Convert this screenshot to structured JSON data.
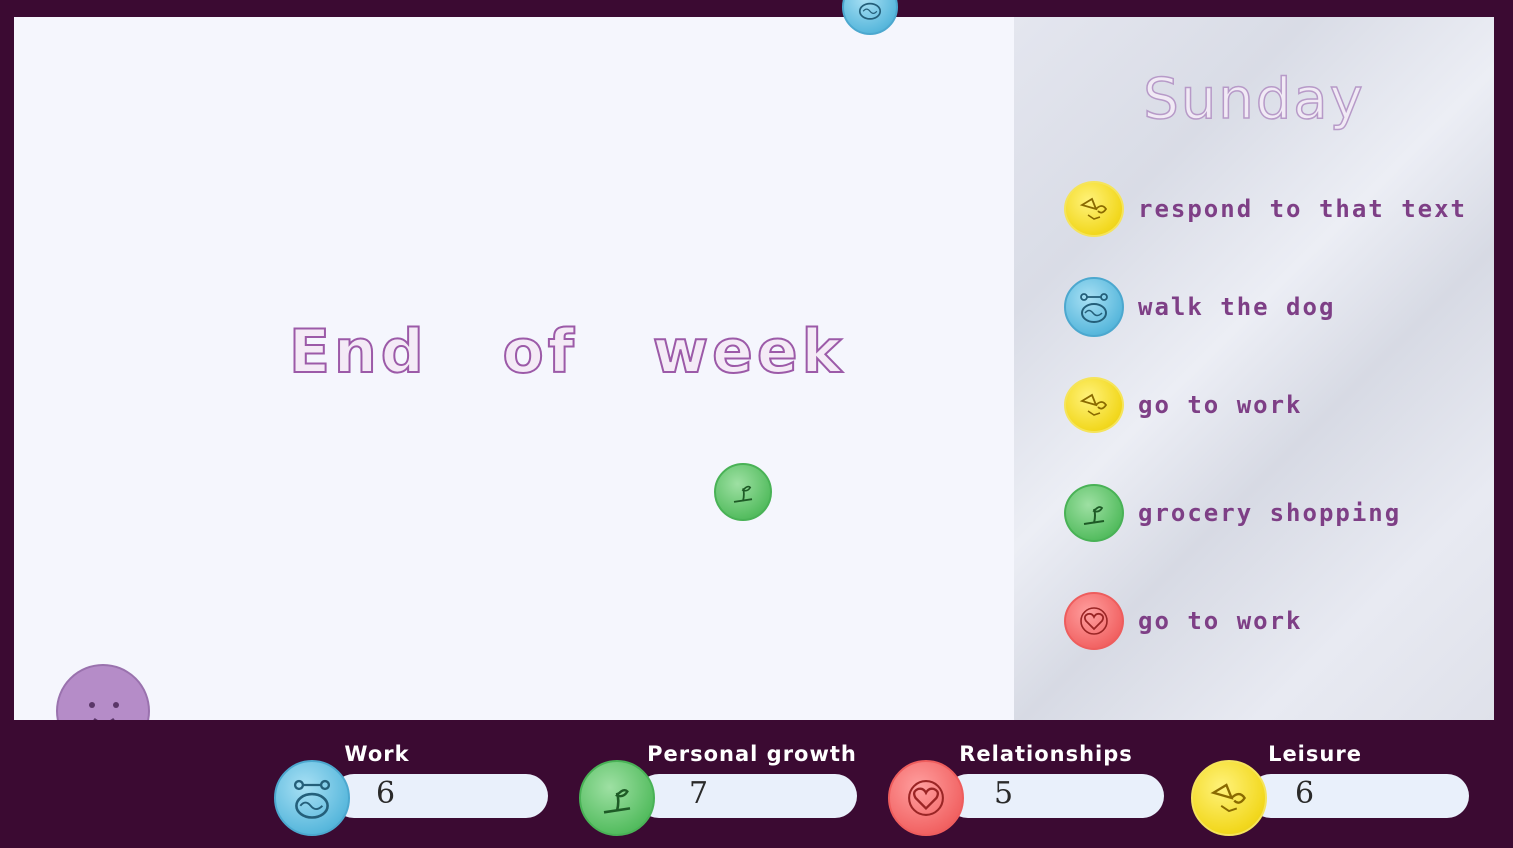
{
  "main": {
    "headline": "End of week"
  },
  "schedule": {
    "day": "Sunday",
    "tasks": [
      {
        "label": "respond to that text",
        "category": "leisure",
        "icon": "kite-icon",
        "color": "#f2d81e"
      },
      {
        "label": "walk the dog",
        "category": "work",
        "icon": "brain-dumbbell-icon",
        "color": "#5bb9dd"
      },
      {
        "label": "go to work",
        "category": "leisure",
        "icon": "kite-icon",
        "color": "#f2d81e"
      },
      {
        "label": "grocery shopping",
        "category": "personal-growth",
        "icon": "sprout-icon",
        "color": "#57be62"
      },
      {
        "label": "go to work",
        "category": "relationships",
        "icon": "heart-icon",
        "color": "#f26565"
      }
    ]
  },
  "stats": [
    {
      "label": "Work",
      "value": "6",
      "icon": "brain-dumbbell-icon",
      "color": "#5bb9dd"
    },
    {
      "label": "Personal growth",
      "value": "7",
      "icon": "sprout-icon",
      "color": "#57be62"
    },
    {
      "label": "Relationships",
      "value": "5",
      "icon": "heart-icon",
      "color": "#f26565"
    },
    {
      "label": "Leisure",
      "value": "6",
      "icon": "kite-icon",
      "color": "#f2d81e"
    }
  ],
  "colors": {
    "frame": "#3b0a32",
    "text_purple": "#7e3f86",
    "avatar": "#b58cc8"
  }
}
